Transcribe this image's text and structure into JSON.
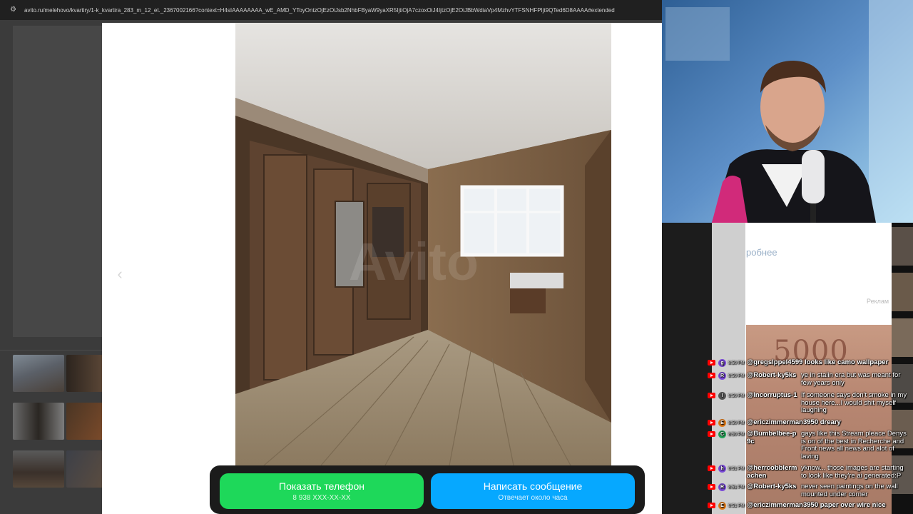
{
  "browser": {
    "url": "avito.ru/melehovo/kvartiry/1-k_kvartira_283_m_12_et._2367002166?context=H4sIAAAAAAAA_wE_AMD_YToyOntzOjEzOiJsb2NhbFByaW9yaXR5IjtiOjA7czoxOiJ4IjtzOjE2OiJBbWdiaVp4MzhvYTFSNHFPIjt9QTed6D8AAAA#extended"
  },
  "gallery": {
    "prev_label": "‹",
    "next_label": "›",
    "watermark": "Avito"
  },
  "actions": {
    "phone_label": "Показать телефон",
    "phone_number": "8 938 XXX-XX-XX",
    "message_label": "Написать сообщение",
    "message_sub": "Отвечает около часа"
  },
  "side": {
    "details_link": "робнее",
    "ad_tag": "Реклам",
    "banknote": "5000"
  },
  "chat": [
    {
      "time": "8:50 PM",
      "avatar": "g",
      "avatar_color": "#7a4ad8",
      "user": "@gregslppel4599",
      "text": "looks like camo wallpaper",
      "inline": true
    },
    {
      "time": "8:50 PM",
      "avatar": "R",
      "avatar_color": "#7a4ad8",
      "user": "@Robert-ky5ks",
      "text": "ye in stalin era but was meant for few years only",
      "inline": false
    },
    {
      "time": "8:50 PM",
      "avatar": "I",
      "avatar_color": "#555555",
      "user": "@Incorruptus-1",
      "text": "If someone says don't smoke in my house here...I would shit myself laughing",
      "inline": false
    },
    {
      "time": "8:50 PM",
      "avatar": "E",
      "avatar_color": "#e07b1a",
      "user": "@ericzimmerman3950",
      "text": "dreary",
      "inline": true
    },
    {
      "time": "8:50 PM",
      "avatar": "C",
      "avatar_color": "#26a65b",
      "user": "@Bumbelbee-p9c",
      "text": "gays like this Stream pleace Denys is on of the best in Recherche and Front news all news and alot of laving",
      "inline": false
    },
    {
      "time": "8:51 PM",
      "avatar": "h",
      "avatar_color": "#7a4ad8",
      "user": "@herrcobblermachen",
      "text": "yknow... those images are starting to look like they're ai generated:P",
      "inline": false
    },
    {
      "time": "8:51 PM",
      "avatar": "R",
      "avatar_color": "#7a4ad8",
      "user": "@Robert-ky5ks",
      "text": "never seen paintings on the wall mounted under corner",
      "inline": false
    },
    {
      "time": "8:51 PM",
      "avatar": "E",
      "avatar_color": "#e07b1a",
      "user": "@ericzimmerman3950",
      "text": "paper over wire nice",
      "inline": true
    }
  ]
}
